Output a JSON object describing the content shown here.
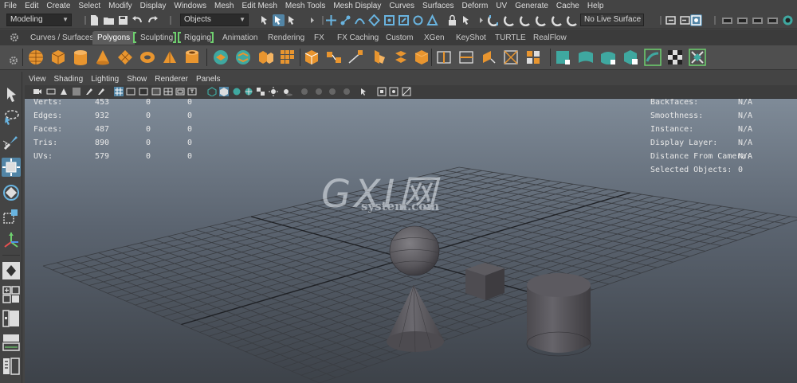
{
  "menubar": {
    "items": [
      "File",
      "Edit",
      "Create",
      "Select",
      "Modify",
      "Display",
      "Windows",
      "Mesh",
      "Edit Mesh",
      "Mesh Tools",
      "Mesh Display",
      "Curves",
      "Surfaces",
      "Deform",
      "UV",
      "Generate",
      "Cache",
      "Help"
    ]
  },
  "statusline": {
    "workspace_menu": "Modeling",
    "selection_mode": "Objects",
    "live_surface": "No Live Surface"
  },
  "shelf_tabs": {
    "items": [
      "Curves / Surfaces",
      "Polygons",
      "Sculpting",
      "Rigging",
      "Animation",
      "Rendering",
      "FX",
      "FX Caching",
      "Custom",
      "XGen",
      "KeyShot",
      "TURTLE",
      "RealFlow"
    ],
    "active": "Polygons"
  },
  "panel_menu": {
    "items": [
      "View",
      "Shading",
      "Lighting",
      "Show",
      "Renderer",
      "Panels"
    ]
  },
  "hud": {
    "poly_count": [
      {
        "label": "Verts:",
        "a": "453",
        "b": "0",
        "c": "0"
      },
      {
        "label": "Edges:",
        "a": "932",
        "b": "0",
        "c": "0"
      },
      {
        "label": "Faces:",
        "a": "487",
        "b": "0",
        "c": "0"
      },
      {
        "label": "Tris:",
        "a": "890",
        "b": "0",
        "c": "0"
      },
      {
        "label": "UVs:",
        "a": "579",
        "b": "0",
        "c": "0"
      }
    ],
    "object_details": [
      {
        "label": "Backfaces:",
        "value": "N/A"
      },
      {
        "label": "Smoothness:",
        "value": "N/A"
      },
      {
        "label": "Instance:",
        "value": "N/A"
      },
      {
        "label": "Display Layer:",
        "value": "N/A"
      },
      {
        "label": "Distance From Camera:",
        "value": "N/A"
      },
      {
        "label": "Selected Objects:",
        "value": "0"
      }
    ]
  },
  "watermark": {
    "big": "GXI网",
    "small": "system.com"
  },
  "colors": {
    "accent": "#5285a6",
    "shelf_icon_orange": "#e8952f",
    "shelf_icon_teal": "#3fa8a0",
    "tab_group_bracket": "#6fd06f",
    "viewport_top": "#7f8b98",
    "viewport_bottom": "#3d4249"
  }
}
